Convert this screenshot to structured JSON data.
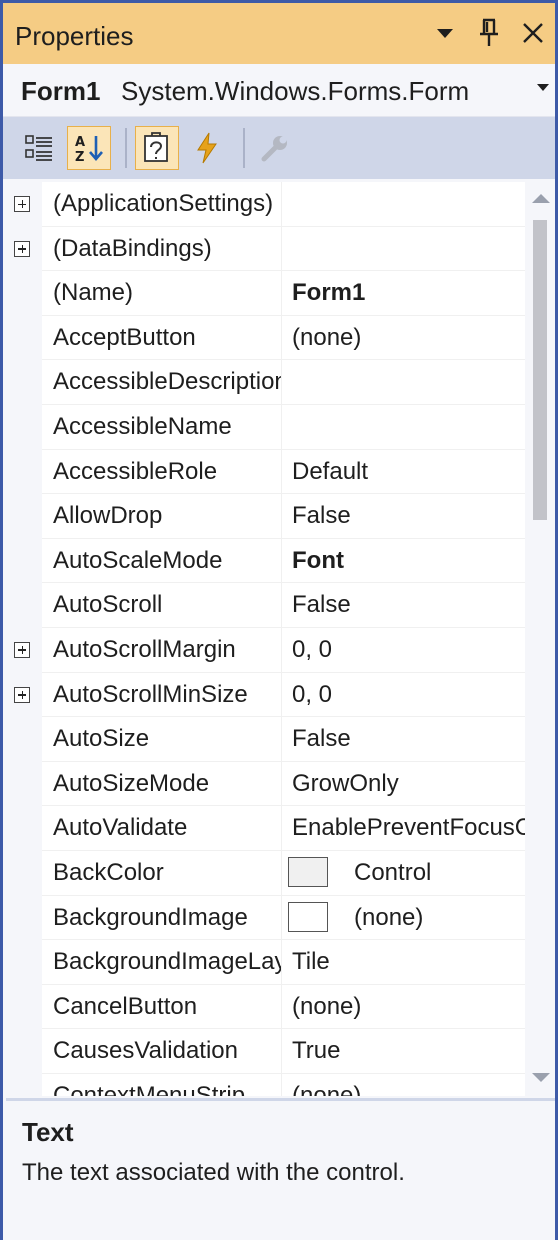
{
  "window": {
    "title": "Properties",
    "icons": [
      "dropdown-arrow-icon",
      "pin-icon",
      "close-icon"
    ]
  },
  "object_selector": {
    "name": "Form1",
    "type": "System.Windows.Forms.Form"
  },
  "toolbar": {
    "buttons": [
      "categorized-icon",
      "alphabetical-icon",
      "properties-icon",
      "events-icon",
      "property-pages-icon"
    ],
    "selected": [
      "alphabetical-icon",
      "properties-icon"
    ]
  },
  "properties": [
    {
      "name": "(ApplicationSettings)",
      "value": "",
      "expandable": true
    },
    {
      "name": "(DataBindings)",
      "value": "",
      "expandable": true
    },
    {
      "name": "(Name)",
      "value": "Form1",
      "bold": true
    },
    {
      "name": "AcceptButton",
      "value": "(none)"
    },
    {
      "name": "AccessibleDescription",
      "value": ""
    },
    {
      "name": "AccessibleName",
      "value": ""
    },
    {
      "name": "AccessibleRole",
      "value": "Default"
    },
    {
      "name": "AllowDrop",
      "value": "False"
    },
    {
      "name": "AutoScaleMode",
      "value": "Font",
      "bold": true
    },
    {
      "name": "AutoScroll",
      "value": "False"
    },
    {
      "name": "AutoScrollMargin",
      "value": "0, 0",
      "expandable": true
    },
    {
      "name": "AutoScrollMinSize",
      "value": "0, 0",
      "expandable": true
    },
    {
      "name": "AutoSize",
      "value": "False"
    },
    {
      "name": "AutoSizeMode",
      "value": "GrowOnly"
    },
    {
      "name": "AutoValidate",
      "value": "EnablePreventFocusChange"
    },
    {
      "name": "BackColor",
      "value": "Control",
      "swatch": "#f0f0f0"
    },
    {
      "name": "BackgroundImage",
      "value": "(none)",
      "swatch": "#ffffff"
    },
    {
      "name": "BackgroundImageLayout",
      "value": "Tile"
    },
    {
      "name": "CancelButton",
      "value": "(none)"
    },
    {
      "name": "CausesValidation",
      "value": "True"
    },
    {
      "name": "ContextMenuStrip",
      "value": "(none)"
    }
  ],
  "description": {
    "title": "Text",
    "text": "The text associated with the control."
  },
  "colors": {
    "titlebar": "#f5cc84",
    "toolbar": "#cfd6e8",
    "border": "#3d5aa8"
  }
}
